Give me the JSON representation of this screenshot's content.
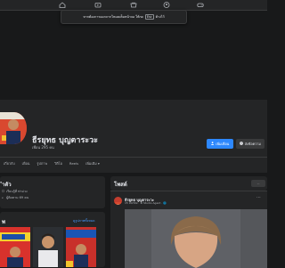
{
  "notice": {
    "text_before": "หากต้องการออกจากโหมดเต็มหน้าจอ ให้กด",
    "key": "Esc",
    "text_after": "ค้างไว้"
  },
  "profile": {
    "name": "ธีรยุทธ บุญตาระวะ",
    "friends": "เพื่อน 295 คน"
  },
  "buttons": {
    "add_friend": "เพิ่มเพื่อน",
    "message": "ส่งข้อความ"
  },
  "tabs": [
    "เกี่ยวกับ",
    "เพื่อน",
    "รูปภาพ",
    "วิดีโอ",
    "Reels",
    "เพิ่มเติม ▾"
  ],
  "intro": {
    "title": "ำตัว",
    "lines": [
      "เรียนรู้ที่ ท่าม่วง",
      "ผู้ติดตาม 69 คน"
    ]
  },
  "photos": {
    "title": "พ",
    "see_all": "ดูรูปภาพทั้งหมด"
  },
  "posts": {
    "title": "โพสต์",
    "filter": "···"
  },
  "post": {
    "author": "ธีรยุทธ บุญตาระวะ",
    "meta": "15 มีนาคม · ⚙ Studio Agent · 🌐",
    "more": "···"
  },
  "colors": {
    "background": "#18191a",
    "card": "#242526",
    "accent": "#2d88ff",
    "secondary_button": "#3a3b3c",
    "text": "#e4e6eb",
    "muted_text": "#b0b3b8",
    "link": "#4599ff"
  },
  "icons": {
    "nav": [
      "home-icon",
      "video-icon",
      "marketplace-icon",
      "groups-icon",
      "gaming-icon"
    ],
    "add_friend": "person-add-icon",
    "message": "messenger-icon",
    "intro_line_1": "globe-icon",
    "intro_line_2": "rss-icon"
  }
}
